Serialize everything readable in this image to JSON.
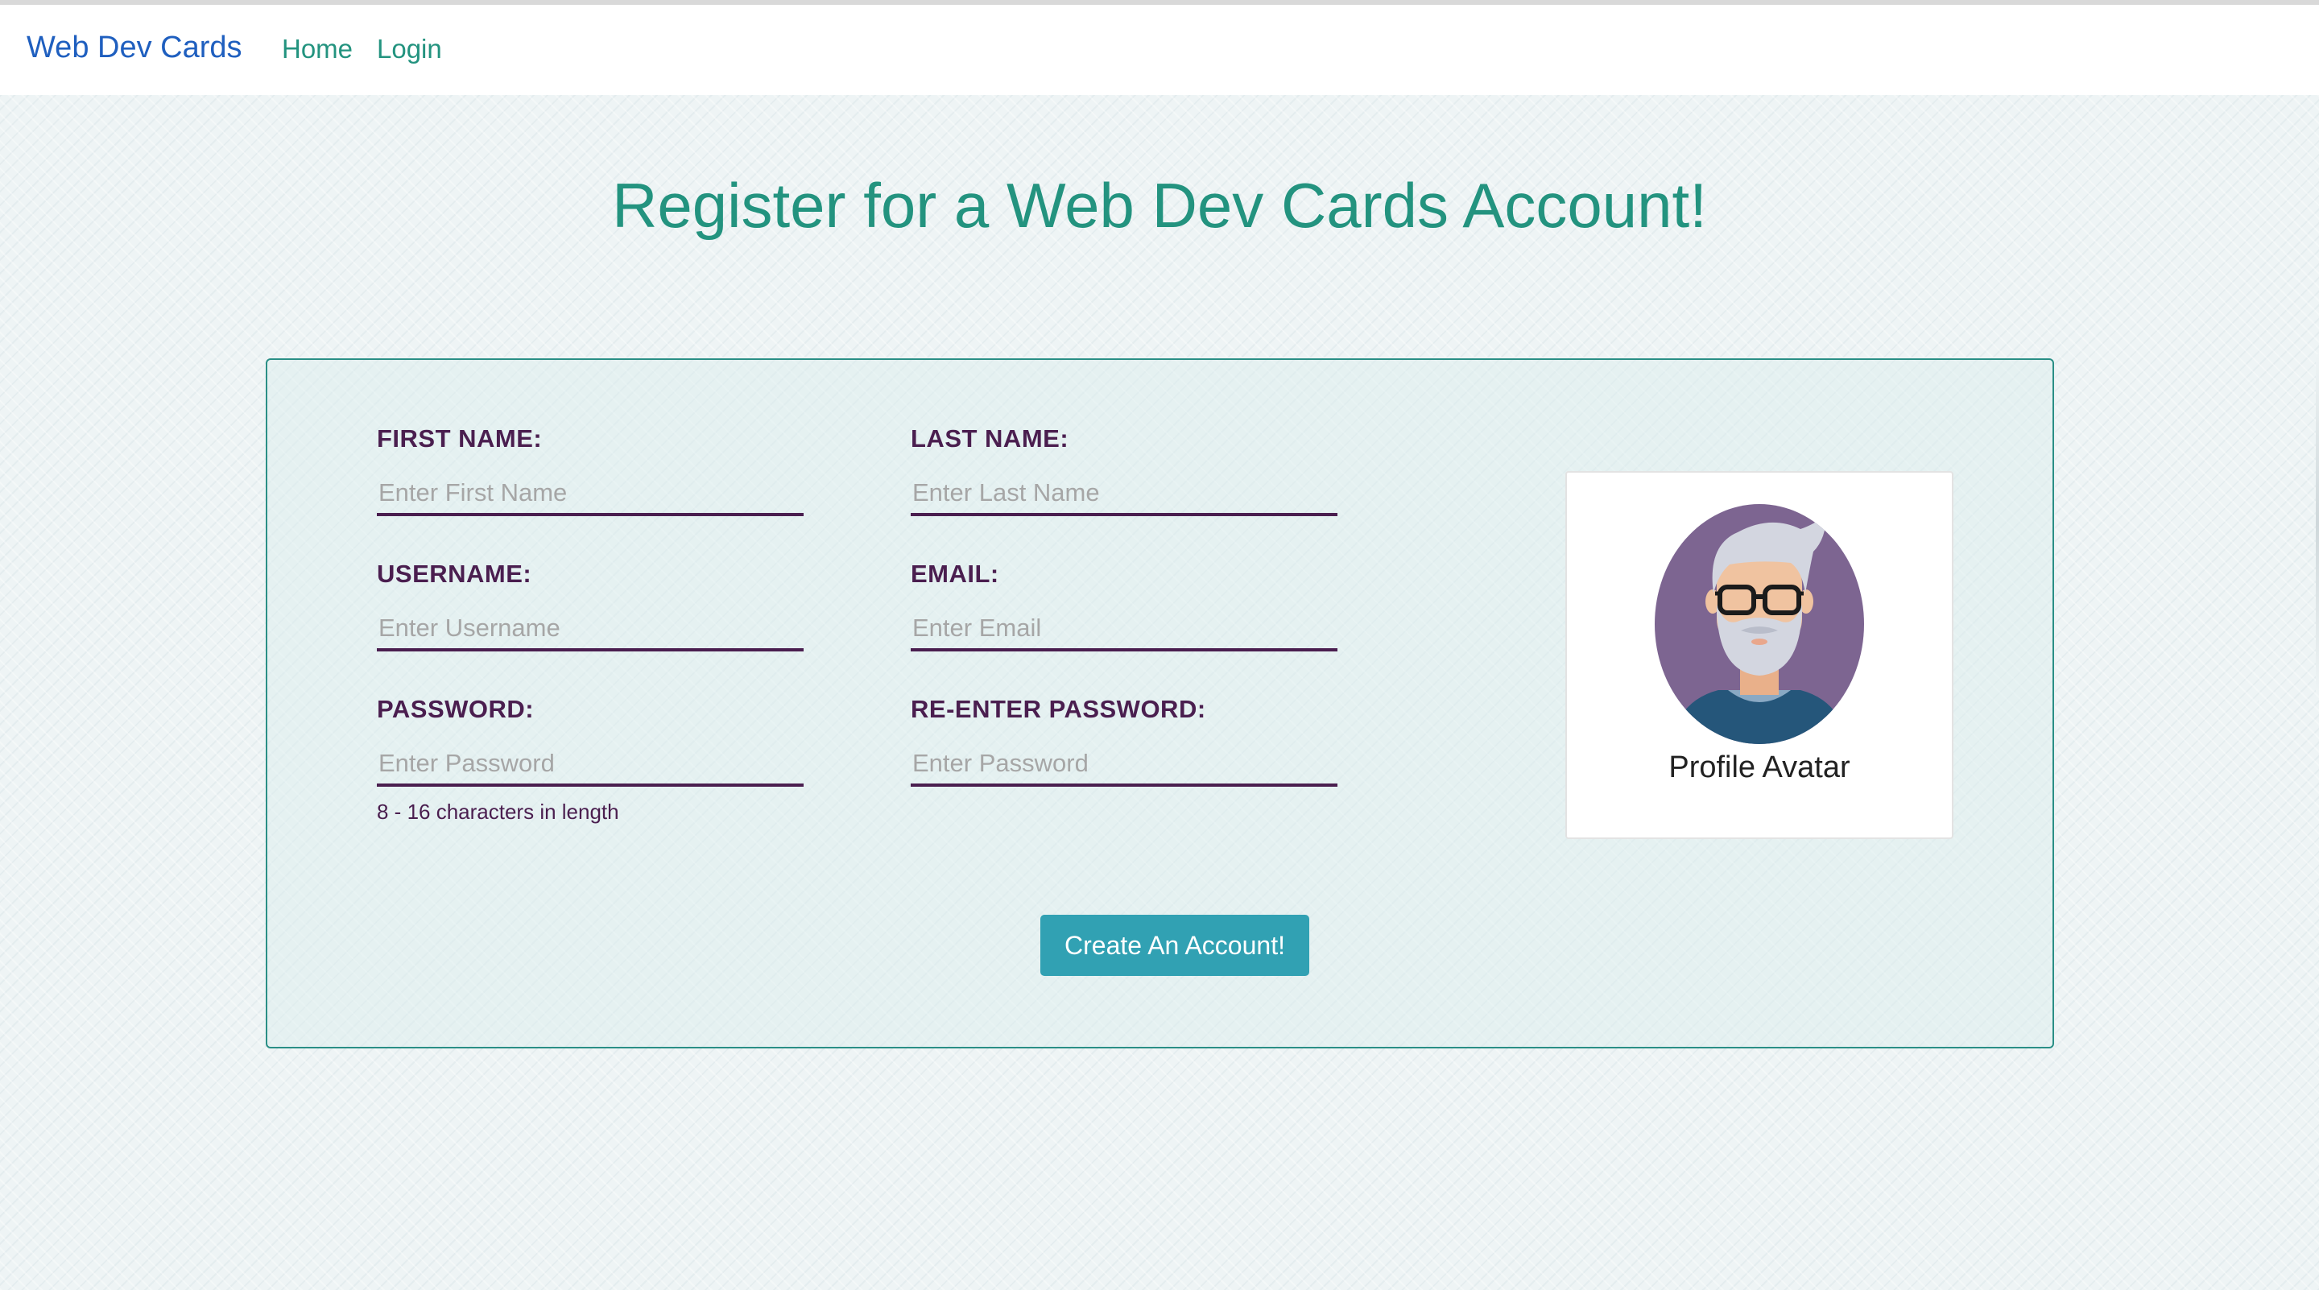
{
  "navbar": {
    "brand": "Web Dev Cards",
    "links": [
      {
        "label": "Home"
      },
      {
        "label": "Login"
      }
    ]
  },
  "page": {
    "title": "Register for a Web Dev Cards Account!"
  },
  "form": {
    "fields": [
      {
        "label": "FIRST NAME:",
        "placeholder": "Enter First Name",
        "value": ""
      },
      {
        "label": "LAST NAME:",
        "placeholder": "Enter Last Name",
        "value": ""
      },
      {
        "label": "USERNAME:",
        "placeholder": "Enter Username",
        "value": ""
      },
      {
        "label": "EMAIL:",
        "placeholder": "Enter Email",
        "value": ""
      },
      {
        "label": "PASSWORD:",
        "placeholder": "Enter Password",
        "value": ""
      },
      {
        "label": "RE-ENTER PASSWORD:",
        "placeholder": "Enter Password",
        "value": ""
      }
    ],
    "password_hint": "8 - 16 characters in length",
    "submit_label": "Create An Account!"
  },
  "avatar": {
    "caption": "Profile Avatar",
    "icon": "bearded-man-with-glasses-avatar",
    "colors": {
      "background": "#7d6591",
      "hair": "#d3d6e0",
      "skin": "#f0c3a0",
      "shirt": "#25567a"
    }
  },
  "theme": {
    "accent": "#23937f",
    "brand": "#1f5fbf",
    "label": "#4a1e4f",
    "button": "#31a1b3"
  }
}
